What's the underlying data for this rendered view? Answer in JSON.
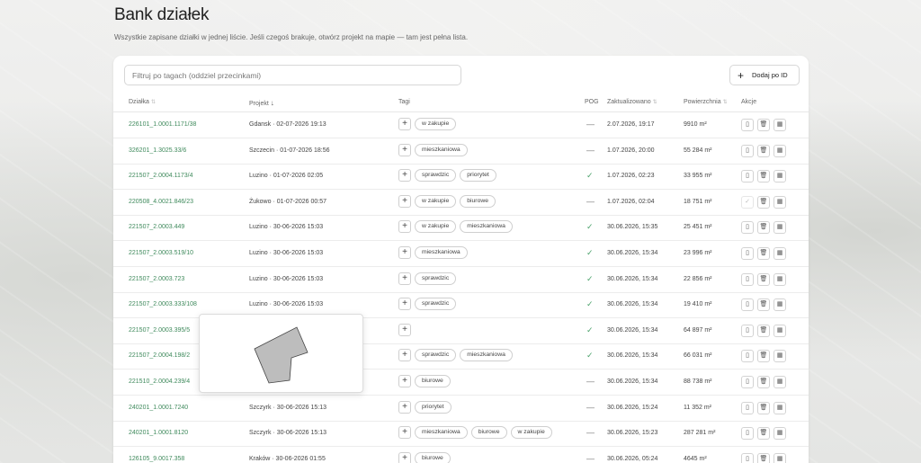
{
  "page": {
    "title": "Bank działek",
    "subtitle": "Wszystkie zapisane działki w jednej liście. Jeśli czegoś brakuje, otwórz projekt na mapie — tam jest pełna lista."
  },
  "toolbar": {
    "filter_placeholder": "Filtruj po tagach (oddziel przecinkami)",
    "add_label": "Dodaj po ID"
  },
  "columns": {
    "id": "Działka",
    "project": "Projekt",
    "tags": "Tagi",
    "pog": "POG",
    "updated": "Zaktualizowano",
    "area": "Powierzchnia",
    "actions": "Akcje"
  },
  "rows": [
    {
      "id": "226101_1.0001.1171/38",
      "project": "Gdansk · 02-07-2026 19:13",
      "tags": [
        "w zakupie"
      ],
      "pog": "dash",
      "updated": "2.07.2026, 19:17",
      "area": "9910 m²"
    },
    {
      "id": "326201_1.3025.33/6",
      "project": "Szczecin · 01-07-2026 18:56",
      "tags": [
        "mieszkaniowa"
      ],
      "pog": "dash",
      "updated": "1.07.2026, 20:00",
      "area": "55 284 m²"
    },
    {
      "id": "221507_2.0004.1173/4",
      "project": "Luzino · 01-07-2026 02:05",
      "tags": [
        "sprawdzic",
        "priorytet"
      ],
      "pog": "check",
      "updated": "1.07.2026, 02:23",
      "area": "33 955 m²"
    },
    {
      "id": "220508_4.0021.846/23",
      "project": "Żukowo · 01-07-2026 00:57",
      "tags": [
        "w zakupie",
        "biurowe"
      ],
      "pog": "dash",
      "updated": "1.07.2026, 02:04",
      "area": "18 751 m²"
    },
    {
      "id": "221507_2.0003.449",
      "project": "Luzino · 30-06-2026 15:03",
      "tags": [
        "w zakupie",
        "mieszkaniowa"
      ],
      "pog": "check",
      "updated": "30.06.2026, 15:35",
      "area": "25 451 m²"
    },
    {
      "id": "221507_2.0003.519/10",
      "project": "Luzino · 30-06-2026 15:03",
      "tags": [
        "mieszkaniowa"
      ],
      "pog": "check",
      "updated": "30.06.2026, 15:34",
      "area": "23 996 m²"
    },
    {
      "id": "221507_2.0003.723",
      "project": "Luzino · 30-06-2026 15:03",
      "tags": [
        "sprawdzic"
      ],
      "pog": "check",
      "updated": "30.06.2026, 15:34",
      "area": "22 856 m²"
    },
    {
      "id": "221507_2.0003.333/108",
      "project": "Luzino · 30-06-2026 15:03",
      "tags": [
        "sprawdzic"
      ],
      "pog": "check",
      "updated": "30.06.2026, 15:34",
      "area": "19 410 m²"
    },
    {
      "id": "221507_2.0003.395/5",
      "project": "",
      "tags": [],
      "pog": "check",
      "updated": "30.06.2026, 15:34",
      "area": "64 897 m²"
    },
    {
      "id": "221507_2.0004.198/2",
      "project": "",
      "tags": [
        "sprawdzic",
        "mieszkaniowa"
      ],
      "pog": "check",
      "updated": "30.06.2026, 15:34",
      "area": "66 031 m²"
    },
    {
      "id": "221510_2.0004.239/4",
      "project": "",
      "tags": [
        "biurowe"
      ],
      "pog": "dash",
      "updated": "30.06.2026, 15:34",
      "area": "88 738 m²"
    },
    {
      "id": "240201_1.0001.7240",
      "project": "Szczyrk · 30-06-2026 15:13",
      "tags": [
        "priorytet"
      ],
      "pog": "dash",
      "updated": "30.06.2026, 15:24",
      "area": "11 352 m²"
    },
    {
      "id": "240201_1.0001.8120",
      "project": "Szczyrk · 30-06-2026 15:13",
      "tags": [
        "mieszkaniowa",
        "biurowe",
        "w zakupie"
      ],
      "pog": "dash",
      "updated": "30.06.2026, 15:23",
      "area": "287 281 m²"
    },
    {
      "id": "126105_9.0017.358",
      "project": "Kraków · 30-06-2026 01:55",
      "tags": [
        "biurowe"
      ],
      "pog": "dash",
      "updated": "30.06.2026, 05:24",
      "area": "4645 m²"
    }
  ],
  "icons": {
    "add": "plus-icon",
    "sort": "sort-icon",
    "sort_active": "arrow-down-icon",
    "pog_yes": "check-icon",
    "pog_no": "dash-icon",
    "actions": [
      "document-icon",
      "trash-icon",
      "map-icon"
    ]
  },
  "colors": {
    "link": "#3f8a5c",
    "check": "#4aa16a"
  }
}
